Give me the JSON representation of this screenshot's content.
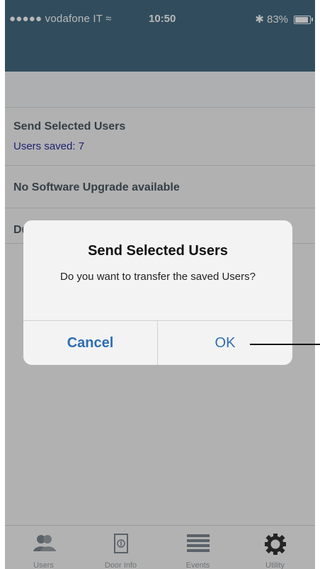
{
  "status_bar": {
    "carrier": "●●●●● vodafone IT ≈",
    "time": "10:50",
    "right": "✱ 83%"
  },
  "list": {
    "row1_title": "Send Selected Users",
    "row1_subtitle": "Users saved: 7",
    "row2_title": "No Software Upgrade available",
    "row3_title": "Du"
  },
  "dialog": {
    "title": "Send Selected Users",
    "message": "Do you want to transfer the saved Users?",
    "cancel_label": "Cancel",
    "ok_label": "OK"
  },
  "tabbar": {
    "items": [
      {
        "label": "Users",
        "icon": "users-icon"
      },
      {
        "label": "Door Info",
        "icon": "door-icon"
      },
      {
        "label": "Events",
        "icon": "list-icon"
      },
      {
        "label": "Utility",
        "icon": "gear-icon"
      }
    ]
  },
  "colors": {
    "nav": "#456b82",
    "link": "#2e6db3",
    "subtitle": "#2a2f9a"
  }
}
